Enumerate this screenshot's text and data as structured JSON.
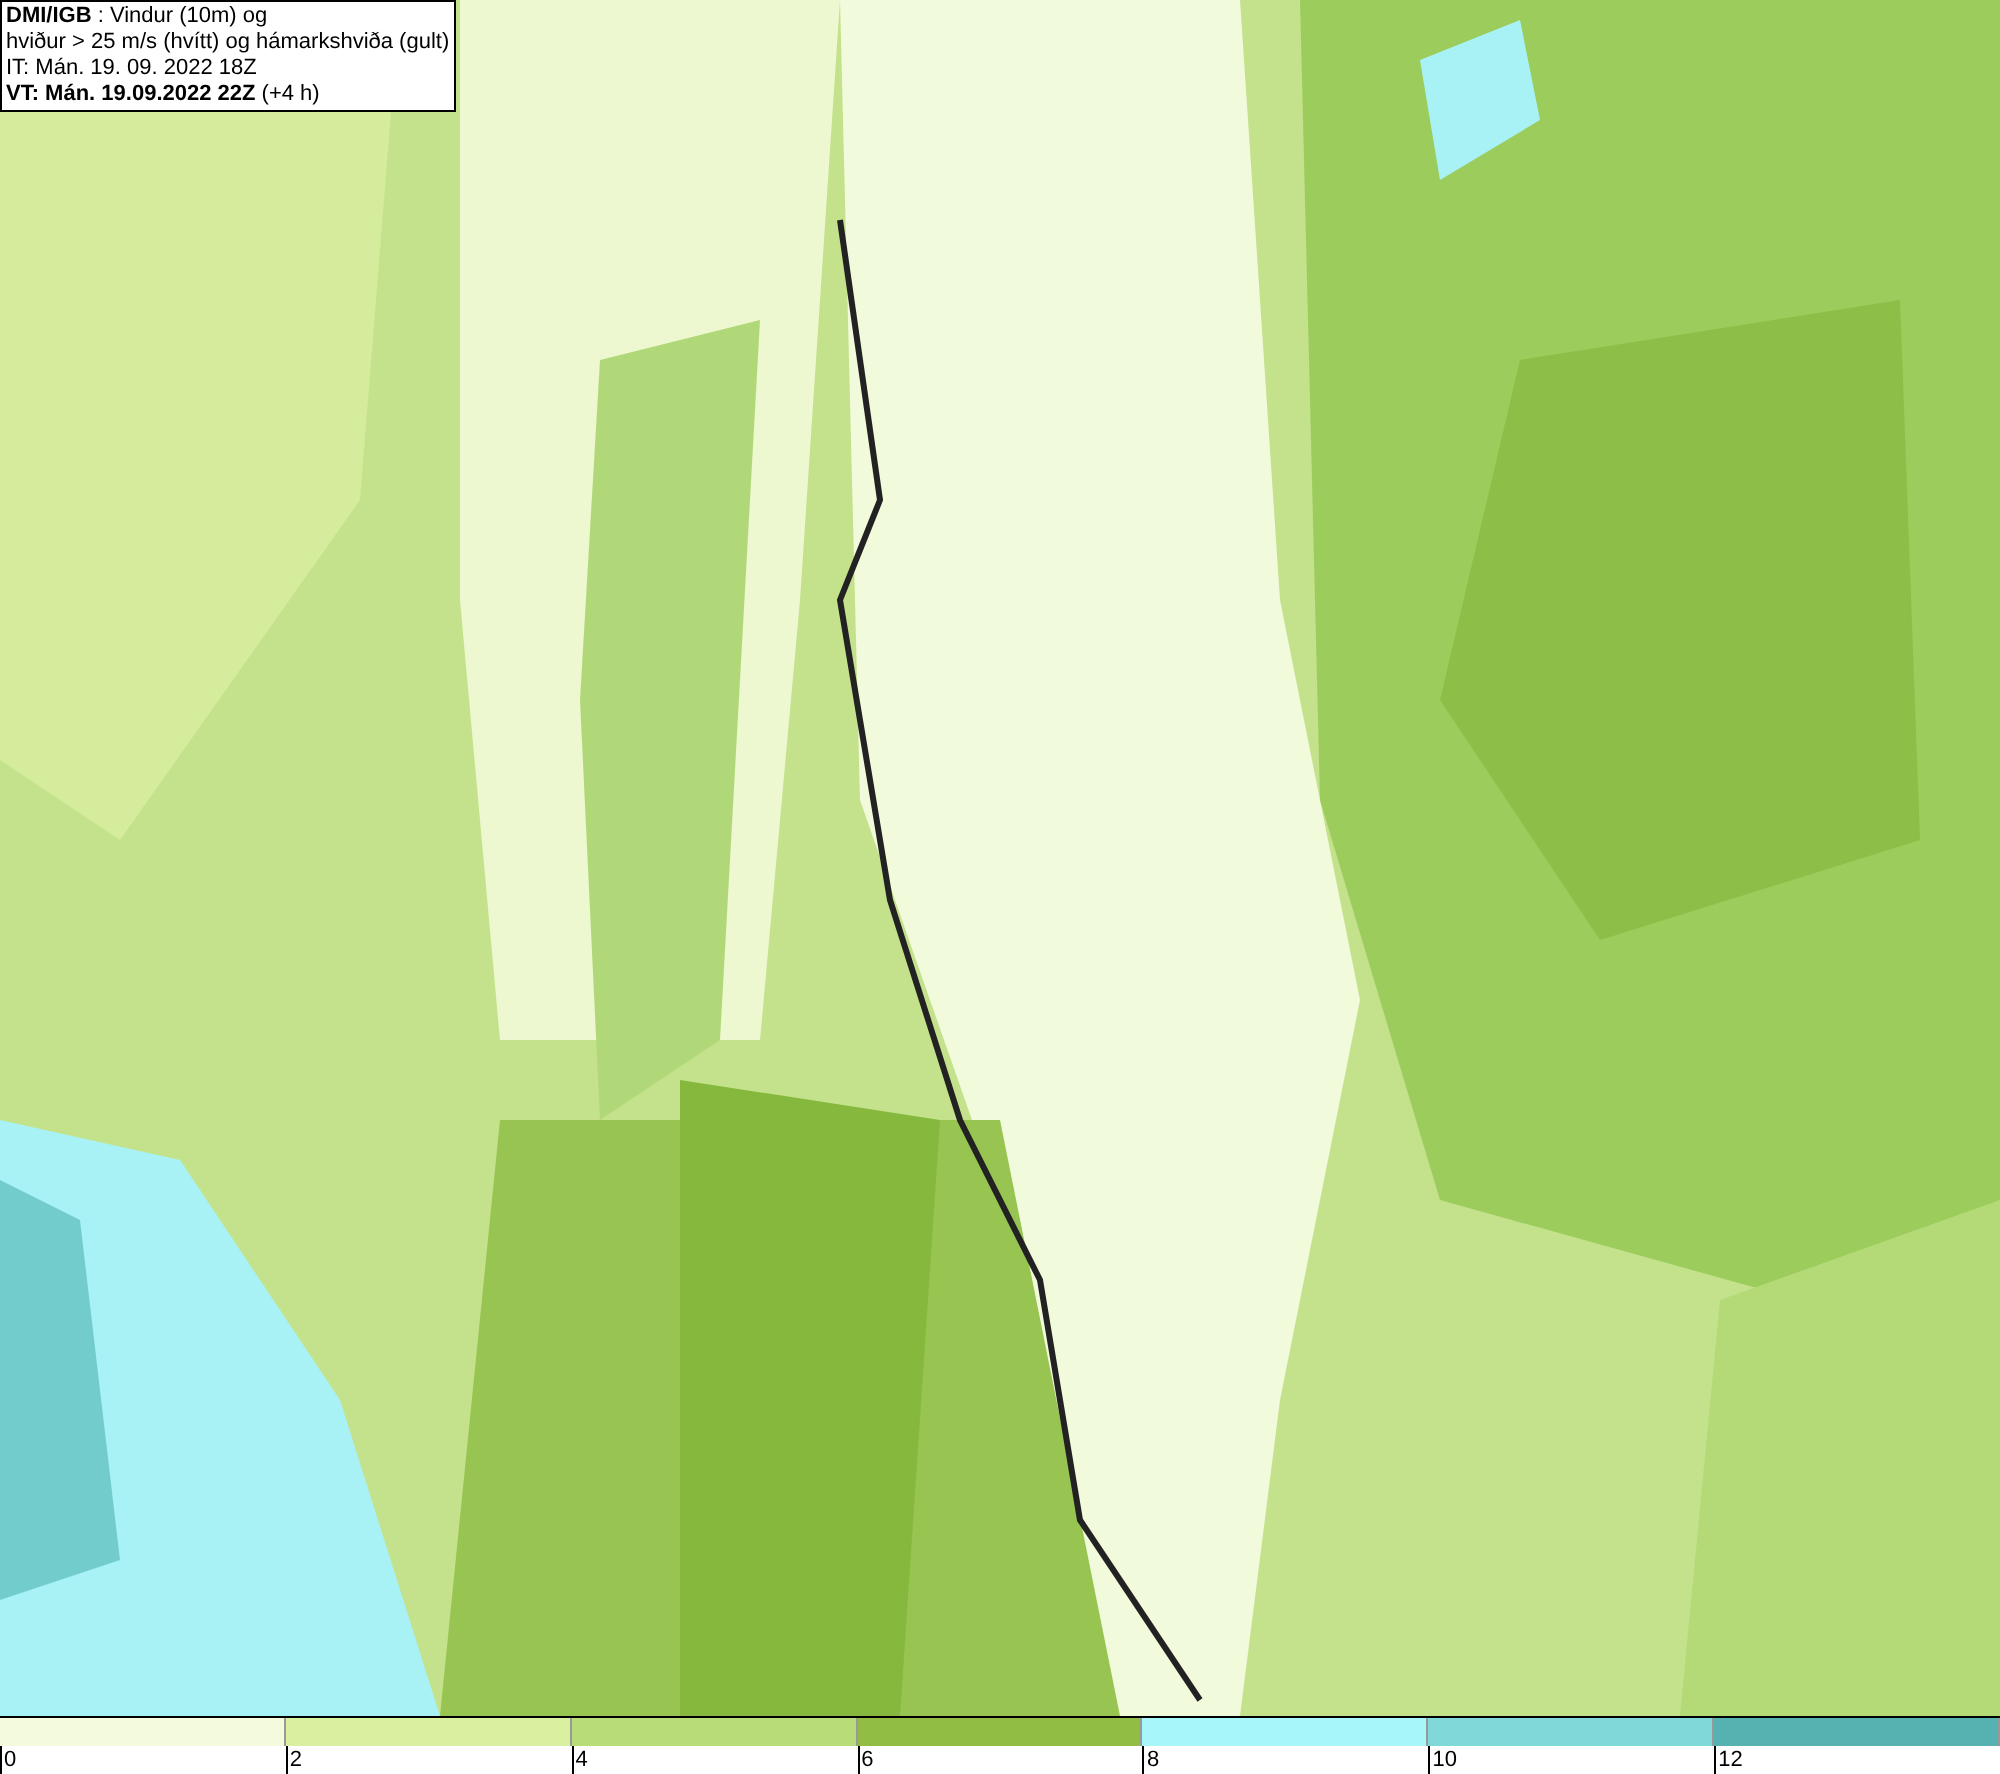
{
  "title_box": {
    "lines": [
      "**DMI/IGB** : Vindur (10m) og",
      "hviður > 25 m/s (hvítt) og hámarkshviða (gult)",
      "IT: Mán. 19. 09. 2022 18Z",
      "**VT: Mán. 19.09.2022 22Z** (+4 h)"
    ]
  },
  "legend": [
    {
      "label": "0",
      "color": "#f4fbdc"
    },
    {
      "label": "2",
      "color": "#d8f0a0"
    },
    {
      "label": "4",
      "color": "#b8dc78"
    },
    {
      "label": "6",
      "color": "#92bd44"
    },
    {
      "label": "8",
      "color": "#a6f6fa"
    },
    {
      "label": "10",
      "color": "#80d8d8"
    },
    {
      "label": "12",
      "color": "#56b1b1"
    }
  ]
}
